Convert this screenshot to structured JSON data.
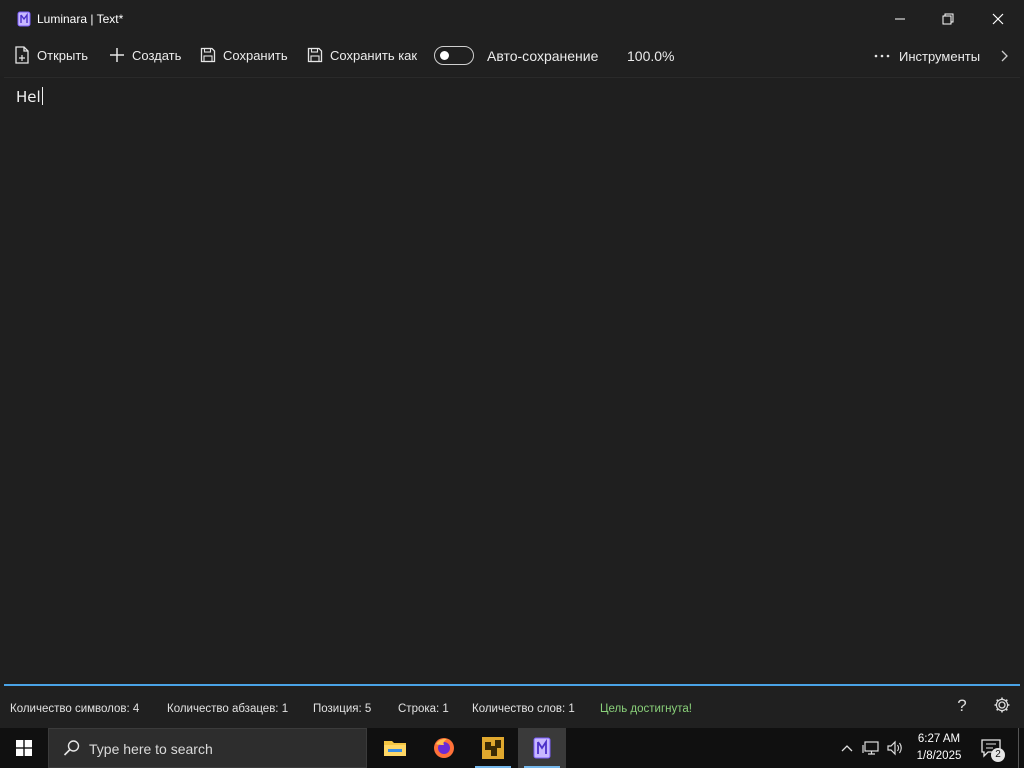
{
  "window": {
    "title": "Luminara | Text*",
    "controls": {
      "minimize": "minimize",
      "maximize": "restore",
      "close": "close"
    }
  },
  "toolbar": {
    "open_label": "Открыть",
    "create_label": "Создать",
    "save_label": "Сохранить",
    "save_as_label": "Сохранить как",
    "autosave_label": "Авто-сохранение",
    "autosave_on": false,
    "zoom": "100.0%",
    "tools_label": "Инструменты"
  },
  "editor": {
    "content": "Hel"
  },
  "status": {
    "chars": "Количество символов: 4",
    "paragraphs": "Количество абзацев: 1",
    "position": "Позиция: 5",
    "line": "Строка: 1",
    "words": "Количество слов: 1",
    "goal": "Цель достигнута!",
    "help": "?"
  },
  "taskbar": {
    "search_placeholder": "Type here to search",
    "apps": [
      "file-explorer",
      "firefox",
      "app-yellow",
      "luminara"
    ],
    "active_app": "luminara",
    "time": "6:27 AM",
    "date": "1/8/2025",
    "notification_count": "2"
  },
  "colors": {
    "accent": "#4aa3e6",
    "goal": "#8ad17a",
    "background": "#1f1f1f"
  }
}
